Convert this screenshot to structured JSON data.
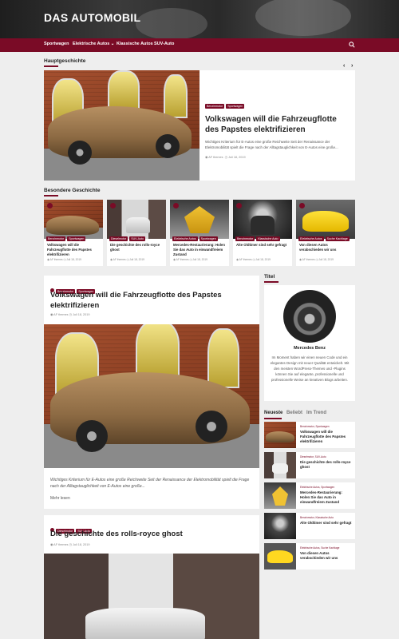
{
  "site": {
    "title": "DAS AUTOMOBIL"
  },
  "nav": {
    "items": [
      "Sportwagen",
      "Elektrische Autos",
      "Klassische Autos",
      "SUV-Auto"
    ],
    "dropdown_icon": "chevron-down-icon",
    "search_icon": "search-icon"
  },
  "colors": {
    "accent": "#7a0b26",
    "background": "#eeeeee"
  },
  "featured": {
    "heading": "Hauptgeschichte",
    "tags": [
      "Benzinmotor",
      "Sportwagen"
    ],
    "title": "Volkswagen will die Fahrzeugflotte des Papstes elektrifizieren",
    "excerpt": "Wichtiges Kriterium für E-Autos eine große Reichweite Seit der Renaissance der Elektromobilität spielt die Frage nach der Alltagstauglichkeit von E-Autos eine große...",
    "author": "AF themes",
    "date": "Juli 18, 2019",
    "prev_arrow": "‹",
    "next_arrow": "›"
  },
  "special": {
    "heading": "Besondere Geschichte",
    "cards": [
      {
        "tags": [
          "Benzinmotor",
          "Sportwagen"
        ],
        "title": "Volkswagen will die Fahrzeugflotte des Papstes elektrifizieren",
        "author": "AF themes",
        "date": "Juli 18, 2019"
      },
      {
        "tags": [
          "Dieselmotor",
          "SUV-Auto"
        ],
        "title": "Die geschichte des rolls-royce ghost",
        "author": "AF themes",
        "date": "Juli 18, 2019"
      },
      {
        "tags": [
          "Elektrische Autos",
          "Sportwagen"
        ],
        "title": "Mercedes-Restaurierung: Holen Sie das Auto in einwandfreiem Zustand",
        "author": "AF themes",
        "date": "Juli 18, 2019"
      },
      {
        "tags": [
          "Benzinmotor",
          "Klassische Auto"
        ],
        "title": "Alte Oldtimer sind sehr gefragt",
        "author": "AF themes",
        "date": "Juli 18, 2019"
      },
      {
        "tags": [
          "Elektrische Autos",
          "Suche Kachlage"
        ],
        "title": "Von diesen Autos verabschieden wir uns",
        "author": "AF themes",
        "date": "Juli 18, 2019"
      }
    ]
  },
  "posts": [
    {
      "tags": [
        "Benzinmotor",
        "Sportwagen"
      ],
      "title": "Volkswagen will die Fahrzeugflotte des Papstes elektrifizieren",
      "author": "AF themes",
      "date": "Juli 18, 2019",
      "excerpt": "Wichtiges Kriterium für E-Autos eine große Reichweite Seit der Renaissance der Elektromobilität spielt die Frage nach der Alltagstauglichkeit von E-Autos eine große...",
      "more": "Mehr lesen"
    },
    {
      "tags": [
        "Dieselmotor",
        "SUV-Auto"
      ],
      "title": "Die geschichte des rolls-royce ghost",
      "author": "AF themes",
      "date": "Juli 18, 2019"
    }
  ],
  "sidebar": {
    "about_heading": "Titel",
    "about_name": "Mercedes Benz",
    "about_text": "Im Moment haben wir einen neuen Code und ein elegantes Design mit neuer Qualität entwickelt. Mit den meisten WordPress-Themes und -Plugins können Sie auf elegante, professionelle und professionelle Weise an kreativen Blogs arbeiten.",
    "tabs": [
      "Neueste",
      "Beliebt",
      "Im Trend"
    ],
    "items": [
      {
        "cat": "Benzinmotor, Sportwagen",
        "title": "Volkswagen will die Fahrzeugflotte des Papstes elektrifizieren"
      },
      {
        "cat": "Dieselmotor, SUV-Auto",
        "title": "Die geschichte des rolls-royce ghost"
      },
      {
        "cat": "Elektrische Autos, Sportwagen",
        "title": "Mercedes-Restaurierung: Holen Sie das Auto in einwandfreiem Zustand"
      },
      {
        "cat": "Benzinmotor, Klassische Auto",
        "title": "Alte Oldtimer sind sehr gefragt"
      },
      {
        "cat": "Elektrische Autos, Suche Kachlage",
        "title": "Von diesen Autos verabschieden wir uns"
      }
    ]
  }
}
